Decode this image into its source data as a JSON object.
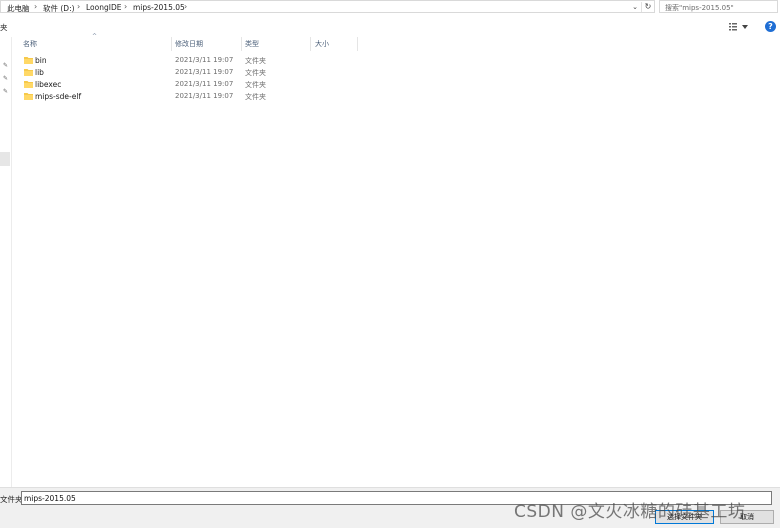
{
  "address": {
    "crumbs": [
      "此电脑",
      "软件 (D:)",
      "LoongIDE",
      "mips-2015.05"
    ]
  },
  "search": {
    "placeholder": "搜索\"mips-2015.05\""
  },
  "toolbar": {
    "left_clip_text": "夹",
    "help_label": "?"
  },
  "columns": {
    "name": "名称",
    "date": "修改日期",
    "type": "类型",
    "size": "大小"
  },
  "files": [
    {
      "name": "bin",
      "date": "2021/3/11 19:07",
      "type": "文件夹"
    },
    {
      "name": "lib",
      "date": "2021/3/11 19:07",
      "type": "文件夹"
    },
    {
      "name": "libexec",
      "date": "2021/3/11 19:07",
      "type": "文件夹"
    },
    {
      "name": "mips-sde-elf",
      "date": "2021/3/11 19:07",
      "type": "文件夹"
    }
  ],
  "footer": {
    "folder_label": "文件夹:",
    "folder_value": "mips-2015.05",
    "select_button": "选择文件夹",
    "cancel_button": "取消"
  },
  "watermark": "CSDN @文火冰糖的硅基工坊",
  "colors": {
    "folder": "#f6c94a",
    "accent": "#0078d7",
    "help": "#1f6ed4"
  }
}
